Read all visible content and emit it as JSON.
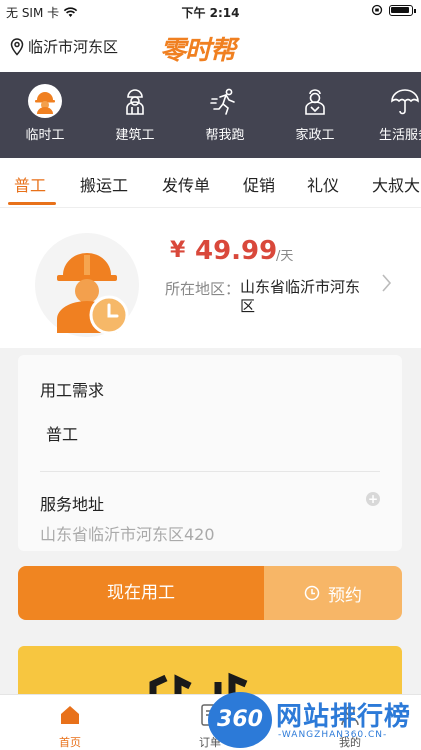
{
  "status_bar": {
    "carrier": "无 SIM 卡",
    "time": "下午 2:14"
  },
  "header": {
    "location": "临沂市河东区",
    "logo_text": "零时帮"
  },
  "categories": [
    {
      "label": "临时工",
      "icon": "helmet-worker-icon",
      "active": true
    },
    {
      "label": "建筑工",
      "icon": "construction-worker-icon"
    },
    {
      "label": "帮我跑",
      "icon": "runner-icon"
    },
    {
      "label": "家政工",
      "icon": "housekeeper-icon"
    },
    {
      "label": "生活服务",
      "icon": "umbrella-icon"
    }
  ],
  "subtabs": [
    "普工",
    "搬运工",
    "发传单",
    "促销",
    "礼仪",
    "大叔大"
  ],
  "worker": {
    "currency": "¥",
    "price": "49.99",
    "unit": "/天",
    "area_label": "所在地区：",
    "area_value": "山东省临沂市河东区"
  },
  "form": {
    "demand_title": "用工需求",
    "demand_value": "普工",
    "address_title": "服务地址",
    "address_value": "山东省临沂市河东区420"
  },
  "actions": {
    "hire_now": "现在用工",
    "book": "预约"
  },
  "nav": {
    "home": "首页",
    "orders": "订单",
    "mine": "我的"
  },
  "watermark": {
    "badge": "360",
    "title": "网站排行榜",
    "sub": "-WANGZHAN360.CN-"
  },
  "colors": {
    "accent": "#e8711a",
    "price": "#d9483b",
    "category_bg": "#434451",
    "book_button": "#f7b667",
    "hire_button": "#f08521"
  }
}
